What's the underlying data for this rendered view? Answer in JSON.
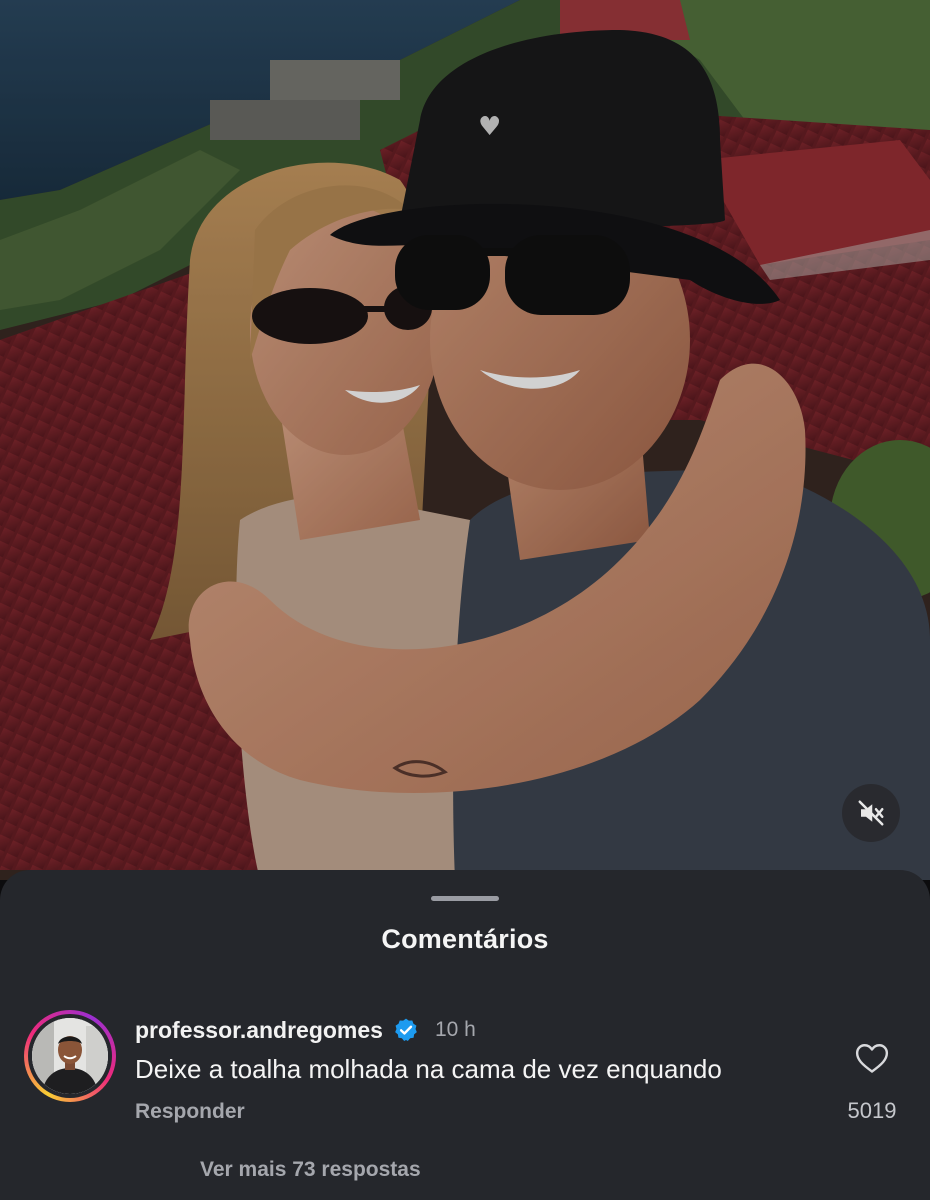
{
  "media": {
    "image_description": "selfie photo",
    "mute_icon": "speaker-muted-icon"
  },
  "comments_sheet": {
    "title": "Comentários",
    "comment": {
      "username": "professor.andregomes",
      "verified_icon": "verified-badge-icon",
      "time": "10 h",
      "text": "Deixe a toalha molhada na cama de vez enquando",
      "reply_label": "Responder",
      "like_icon": "heart-outline-icon",
      "like_count": "5019",
      "view_replies_label": "Ver mais 73 respostas"
    }
  },
  "colors": {
    "sheet_background": "#25272c",
    "verified_blue": "#1d9bf0",
    "secondary_text": "#a5a7ad",
    "primary_text": "#f4f4f4"
  }
}
